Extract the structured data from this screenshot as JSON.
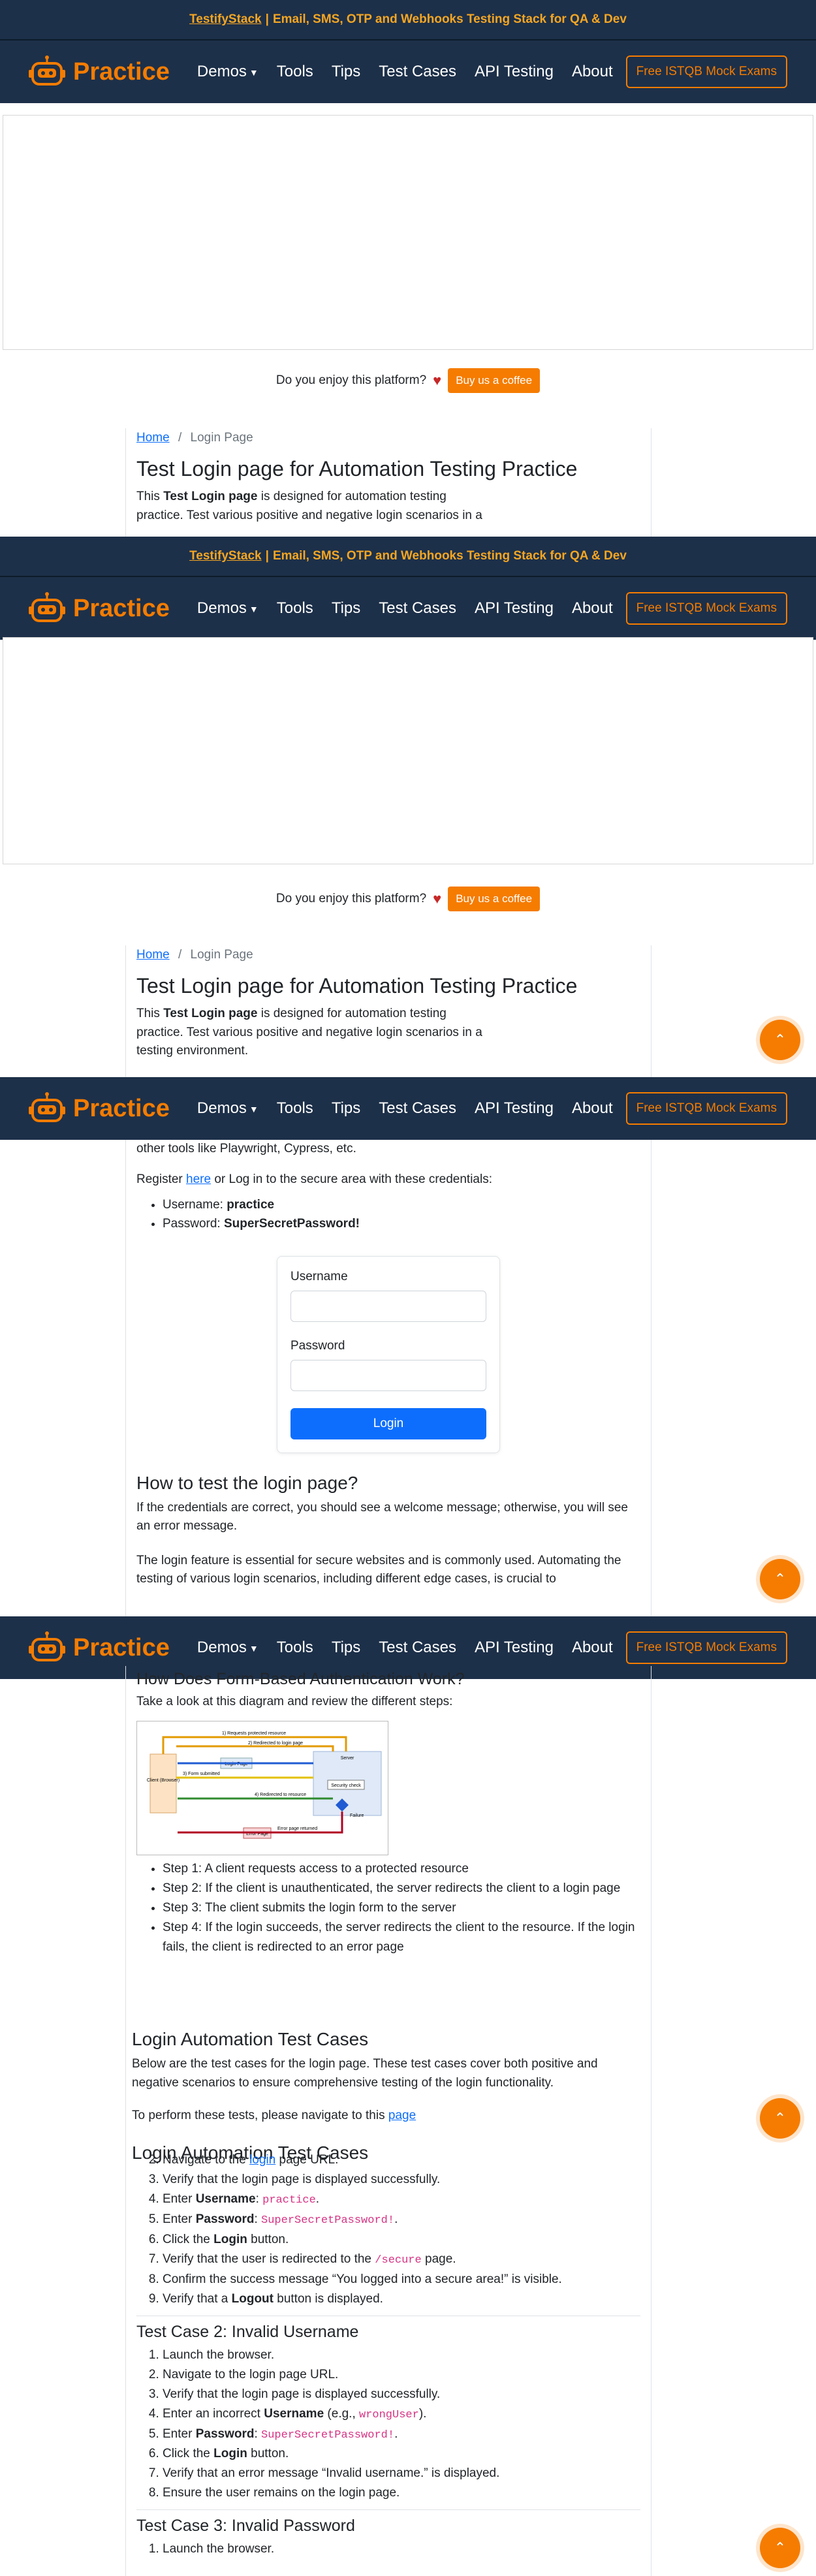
{
  "promo": {
    "brand": "TestifyStack",
    "sep": "|",
    "text": "Email, SMS, OTP and Webhooks Testing Stack for QA & Dev"
  },
  "nav": {
    "brand": "Practice",
    "links": [
      "Demos",
      "Tools",
      "Tips",
      "Test Cases",
      "API Testing",
      "About"
    ],
    "istqb": "Free ISTQB Mock Exams"
  },
  "coffee": {
    "question": "Do you enjoy this platform?",
    "button": "Buy us a coffee"
  },
  "breadcrumb": {
    "home": "Home",
    "sep": "/",
    "current": "Login Page"
  },
  "page": {
    "title": "Test Login page for Automation Testing Practice",
    "intro_pre": "This ",
    "intro_bold": "Test Login page",
    "intro_post": " is designed for automation testing practice. Test various positive and negative login scenarios in a",
    "intro_post2": " is designed for automation testing practice. Test various positive and negative login scenarios in a testing environment.",
    "tools": "other tools like Playwright, Cypress, etc.",
    "register_pre": "Register ",
    "register_link": "here",
    "register_post": " or Log in to the secure area with these credentials:",
    "username_label": "Username: ",
    "username_value": "practice",
    "password_label": "Password: ",
    "password_value": "SuperSecretPassword!"
  },
  "login_form": {
    "username_label": "Username",
    "password_label": "Password",
    "button": "Login"
  },
  "how_to": {
    "heading": "How to test the login page?",
    "p1": "If the credentials are correct, you should see a welcome message; otherwise, you will see an error message.",
    "p2": "The login feature is essential for secure websites and is commonly used. Automating the testing of various login scenarios, including different edge cases, is crucial to"
  },
  "form_auth": {
    "heading": "How Does Form-Based Authentication Work?",
    "intro": "Take a look at this diagram and review the different steps:",
    "diagram": {
      "client": "Client (Browser)",
      "server": "Server",
      "login_page": "Login Page",
      "error_page": "Error Page",
      "security_check": "Security check",
      "failure": "Failure",
      "s1": "1) Requests protected resource",
      "s2": "2) Redirected to login page",
      "s3": "3) Form submitted",
      "s4": "4) Redirected to resource",
      "s5": "Error page returned"
    },
    "steps": [
      "Step 1: A client requests access to a protected resource",
      "Step 2: If the client is unauthenticated, the server redirects the client to a login page",
      "Step 3: The client submits the login form to the server",
      "Step 4: If the login succeeds, the server redirects the client to the resource. If the login fails, the client is redirected to an error page"
    ]
  },
  "cases": {
    "heading": "Login Automation Test Cases",
    "p1": "Below are the test cases for the login page. These test cases cover both positive and negative scenarios to ensure comprehensive testing of the login functionality.",
    "p2_pre": "To perform these tests, please navigate to this ",
    "p2_link": "page",
    "tc1_item2_pre": "Navigate to the ",
    "tc1_item2_link": "login",
    "tc1_item2_post": " page URL.",
    "tc1": {
      "i3": "Verify that the login page is displayed successfully.",
      "i4_pre": "Enter ",
      "i4_bold": "Username",
      "i4_code": "practice",
      "i5_pre": "Enter ",
      "i5_bold": "Password",
      "i5_code": "SuperSecretPassword!",
      "i6_pre": "Click the ",
      "i6_bold": "Login",
      "i6_post": " button.",
      "i7_pre": "Verify that the user is redirected to the ",
      "i7_code": "/secure",
      "i7_post": " page.",
      "i8": "Confirm the success message “You logged into a secure area!” is visible.",
      "i9_pre": "Verify that a ",
      "i9_bold": "Logout",
      "i9_post": " button is displayed."
    },
    "tc2": {
      "heading": "Test Case 2: Invalid Username",
      "i1": "Launch the browser.",
      "i2": "Navigate to the login page URL.",
      "i3": "Verify that the login page is displayed successfully.",
      "i4_pre": "Enter an incorrect ",
      "i4_bold": "Username",
      "i4_mid": " (e.g., ",
      "i4_code": "wrongUser",
      "i4_post": ").",
      "i5_pre": "Enter ",
      "i5_bold": "Password",
      "i5_code": "SuperSecretPassword!",
      "i6_pre": "Click the ",
      "i6_bold": "Login",
      "i6_post": " button.",
      "i7": "Verify that an error message “Invalid username.” is displayed.",
      "i8": "Ensure the user remains on the login page."
    },
    "tc3": {
      "heading": "Test Case 3: Invalid Password",
      "i1": "Launch the browser."
    }
  },
  "colors": {
    "nav_bg": "#1d3049",
    "accent": "#f57c00",
    "primary": "#0d6efd"
  },
  "icons": {
    "fab": "chevron-up-icon",
    "logo": "robot-icon",
    "heart": "heart-icon"
  }
}
